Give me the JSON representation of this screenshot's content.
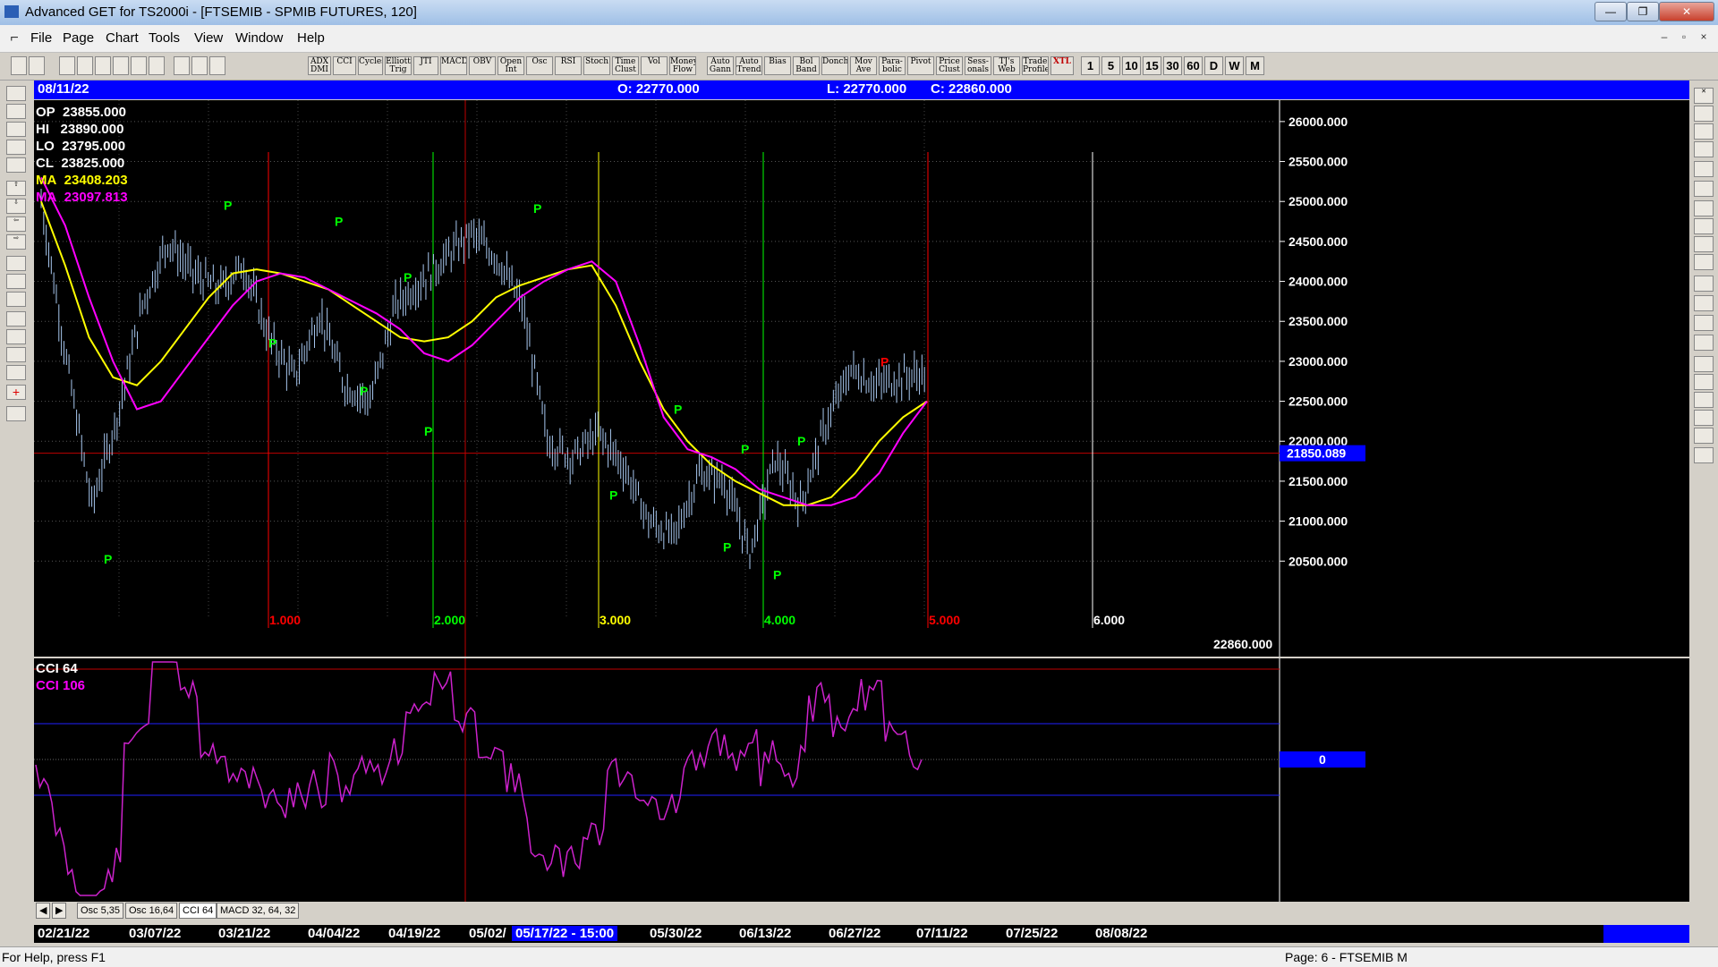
{
  "window": {
    "title": "Advanced GET for TS2000i - [FTSEMIB - SPMIB FUTURES, 120]",
    "minimize": "—",
    "maximize": "❐",
    "close": "✕",
    "mdi_min": "–",
    "mdi_max": "▫",
    "mdi_close": "×"
  },
  "menu": [
    "File",
    "Page",
    "Chart",
    "Tools",
    "View",
    "Window",
    "Help"
  ],
  "toolbar": {
    "studies": [
      "ADX DMI",
      "CCI",
      "Cycles",
      "Elliott Trig",
      "JTI",
      "MACD",
      "OBV",
      "Open Int",
      "Osc",
      "RSI",
      "Stoch",
      "Time Clust",
      "Vol",
      "Money Flow",
      "Auto Gann",
      "Auto Trend",
      "Bias",
      "Bol Band",
      "Donch",
      "Mov Ave",
      "Para- bolic",
      "Pivot",
      "Price Clust",
      "Sess- onals",
      "TJ's Web",
      "Trade Profile",
      "XTL"
    ],
    "intervals": [
      "1",
      "5",
      "10",
      "15",
      "30",
      "60",
      "D",
      "W",
      "M"
    ]
  },
  "left_tools": [
    "Print",
    "Elliott",
    "Reset",
    "Study",
    "Up",
    "Down",
    "Left",
    "Right",
    "Zoom",
    "Move",
    "Comp",
    "Lines",
    "Gann",
    "Fib",
    "Cross",
    "Save"
  ],
  "right_tools": [
    "Cursor",
    "Pen",
    "Line",
    "FIB RET",
    "FIB EXT",
    "FIB TIME",
    "Wheel",
    "Erase",
    "Box",
    "ELPS",
    "PTI",
    "Grid",
    "MOB",
    "A",
    "Magnify",
    "Pen2",
    "Calc",
    "Dollar",
    "Sheet",
    "U"
  ],
  "header": {
    "date": "08/11/22",
    "open": "O: 22770.000",
    "low": "L: 22770.000",
    "close": "C: 22860.000"
  },
  "legend": [
    {
      "label": "OP",
      "value": "23855.000",
      "color": "#ffffff"
    },
    {
      "label": "HI",
      "value": "23890.000",
      "color": "#ffffff"
    },
    {
      "label": "LO",
      "value": "23795.000",
      "color": "#ffffff"
    },
    {
      "label": "CL",
      "value": "23825.000",
      "color": "#ffffff"
    },
    {
      "label": "MA",
      "value": "23408.203",
      "color": "#ffff00"
    },
    {
      "label": "MA",
      "value": "23097.813",
      "color": "#ff00ff"
    }
  ],
  "price_axis": [
    "26000.000",
    "25500.000",
    "25000.000",
    "24500.000",
    "24000.000",
    "23500.000",
    "23000.000",
    "22500.000",
    "22000.000",
    "21500.000",
    "21000.000",
    "20500.000"
  ],
  "cursor_price": "21850.089",
  "last_price": "22860.000",
  "cycle_labels": [
    {
      "text": "1.000",
      "color": "#ff0000"
    },
    {
      "text": "2.000",
      "color": "#00ff00"
    },
    {
      "text": "3.000",
      "color": "#ffff00"
    },
    {
      "text": "4.000",
      "color": "#00ff00"
    },
    {
      "text": "5.000",
      "color": "#ff0000"
    },
    {
      "text": "6.000",
      "color": "#ffffff"
    }
  ],
  "pivot_label": "P",
  "cci_legend": [
    {
      "text": "CCI 64",
      "color": "#ffffff"
    },
    {
      "text": "CCI  106",
      "color": "#ff00ff"
    }
  ],
  "cci_zero": "0",
  "tabs": [
    "Osc 5,35",
    "Osc 16,64",
    "CCI 64",
    "MACD 32, 64, 32"
  ],
  "tab_nav": [
    "◀",
    "▶"
  ],
  "date_axis": [
    "02/21/22",
    "03/07/22",
    "03/21/22",
    "04/04/22",
    "04/19/22",
    "05/02/",
    "05/17/22 - 15:00",
    "05/30/22",
    "06/13/22",
    "06/27/22",
    "07/11/22",
    "07/25/22",
    "08/08/22"
  ],
  "status": {
    "help": "For Help, press F1",
    "page": "Page: 6 - FTSEMIB M"
  },
  "colors": {
    "price_bars": "#a8c8f0",
    "ma_fast": "#ffff00",
    "ma_slow": "#ff00ff",
    "cci": "#cc22cc",
    "header": "#0000ff"
  },
  "chart_data": {
    "type": "ohlc-bar",
    "y_range": [
      20100,
      26200
    ],
    "moving_average_yellow": [
      25000,
      24200,
      23300,
      22800,
      22700,
      23000,
      23400,
      23800,
      24100,
      24150,
      24100,
      24000,
      23900,
      23700,
      23500,
      23300,
      23250,
      23300,
      23500,
      23800,
      23950,
      24050,
      24150,
      24200,
      23700,
      23000,
      22400,
      22000,
      21700,
      21500,
      21350,
      21200,
      21200,
      21300,
      21600,
      22000,
      22300,
      22500
    ],
    "moving_average_magenta": [
      25300,
      24700,
      23800,
      23000,
      22400,
      22500,
      22900,
      23300,
      23700,
      24000,
      24100,
      24050,
      23900,
      23750,
      23600,
      23400,
      23100,
      23000,
      23200,
      23500,
      23800,
      24000,
      24150,
      24250,
      24000,
      23200,
      22300,
      21900,
      21800,
      21650,
      21400,
      21300,
      21200,
      21200,
      21300,
      21600,
      22100,
      22500
    ],
    "price_close": [
      25000,
      23000,
      21200,
      22300,
      23700,
      24500,
      24100,
      23900,
      24200,
      23300,
      22800,
      23600,
      22700,
      22500,
      23700,
      24000,
      24300,
      24600,
      24300,
      23700,
      22000,
      21800,
      22100,
      21700,
      21000,
      20800,
      21600,
      21500,
      20600,
      21800,
      21200,
      22200,
      22900,
      22700,
      22800,
      22860
    ]
  }
}
